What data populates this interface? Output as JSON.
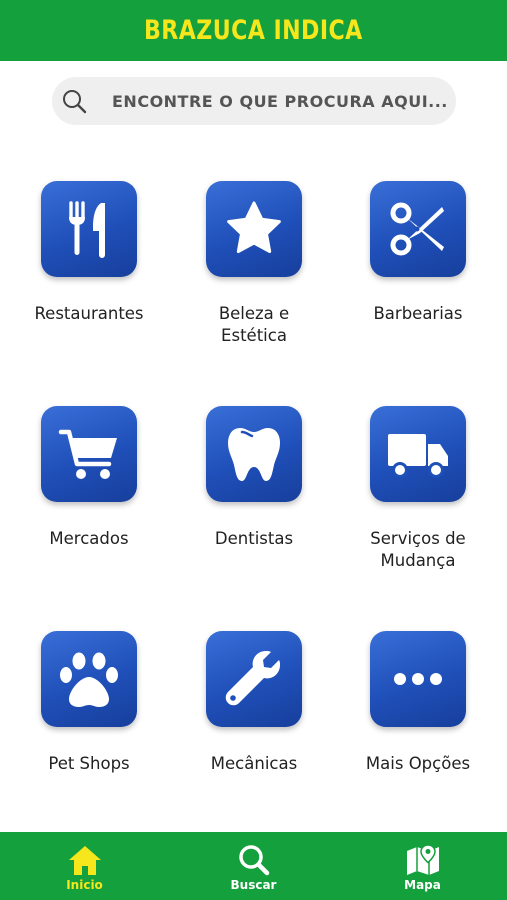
{
  "header": {
    "title": "BRAZUCA INDICA"
  },
  "search": {
    "placeholder": "ENCONTRE O QUE PROCURA AQUI..."
  },
  "categories": [
    {
      "lines": [
        "Restaurantes"
      ],
      "icon": "fork-knife-icon"
    },
    {
      "lines": [
        "Beleza e",
        "Estética"
      ],
      "icon": "star-icon"
    },
    {
      "lines": [
        "Barbearias"
      ],
      "icon": "scissors-icon"
    },
    {
      "lines": [
        "Mercados"
      ],
      "icon": "shopping-cart-icon"
    },
    {
      "lines": [
        "Dentistas"
      ],
      "icon": "tooth-icon"
    },
    {
      "lines": [
        "Serviços de",
        "Mudança"
      ],
      "icon": "truck-icon"
    },
    {
      "lines": [
        "Pet Shops"
      ],
      "icon": "paw-icon"
    },
    {
      "lines": [
        "Mecânicas"
      ],
      "icon": "wrench-icon"
    },
    {
      "lines": [
        "Mais Opções"
      ],
      "icon": "more-dots-icon"
    }
  ],
  "nav": {
    "items": [
      {
        "label": "Inicio",
        "icon": "home-icon",
        "active": true
      },
      {
        "label": "Buscar",
        "icon": "search-icon",
        "active": false
      },
      {
        "label": "Mapa",
        "icon": "map-icon",
        "active": false
      }
    ]
  },
  "colors": {
    "brand_green": "#14a03c",
    "brand_yellow": "#f6e61c",
    "tile_blue": "#1f4fb8"
  }
}
